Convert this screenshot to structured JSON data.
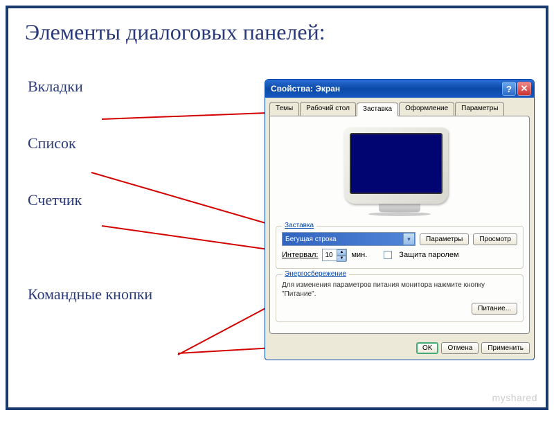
{
  "slide": {
    "title": "Элементы диалоговых панелей:"
  },
  "labels": {
    "tabs": "Вкладки",
    "list": "Список",
    "spinner": "Счетчик",
    "command_buttons": "Командные кнопки"
  },
  "dialog": {
    "title": "Свойства: Экран",
    "tabs": [
      "Темы",
      "Рабочий стол",
      "Заставка",
      "Оформление",
      "Параметры"
    ],
    "active_tab": 2,
    "group_zastavka": {
      "title": "Заставка",
      "dropdown_value": "Бегущая строка",
      "btn_params": "Параметры",
      "btn_preview": "Просмотр",
      "interval_label": "Интервал:",
      "interval_value": "10",
      "interval_unit": "мин.",
      "checkbox_label": "Защита паролем"
    },
    "group_energy": {
      "title": "Энергосбережение",
      "note": "Для изменения параметров питания монитора нажмите кнопку \"Питание\".",
      "btn_power": "Питание..."
    },
    "buttons": {
      "ok": "OK",
      "cancel": "Отмена",
      "apply": "Применить"
    }
  },
  "watermark": "myshared"
}
